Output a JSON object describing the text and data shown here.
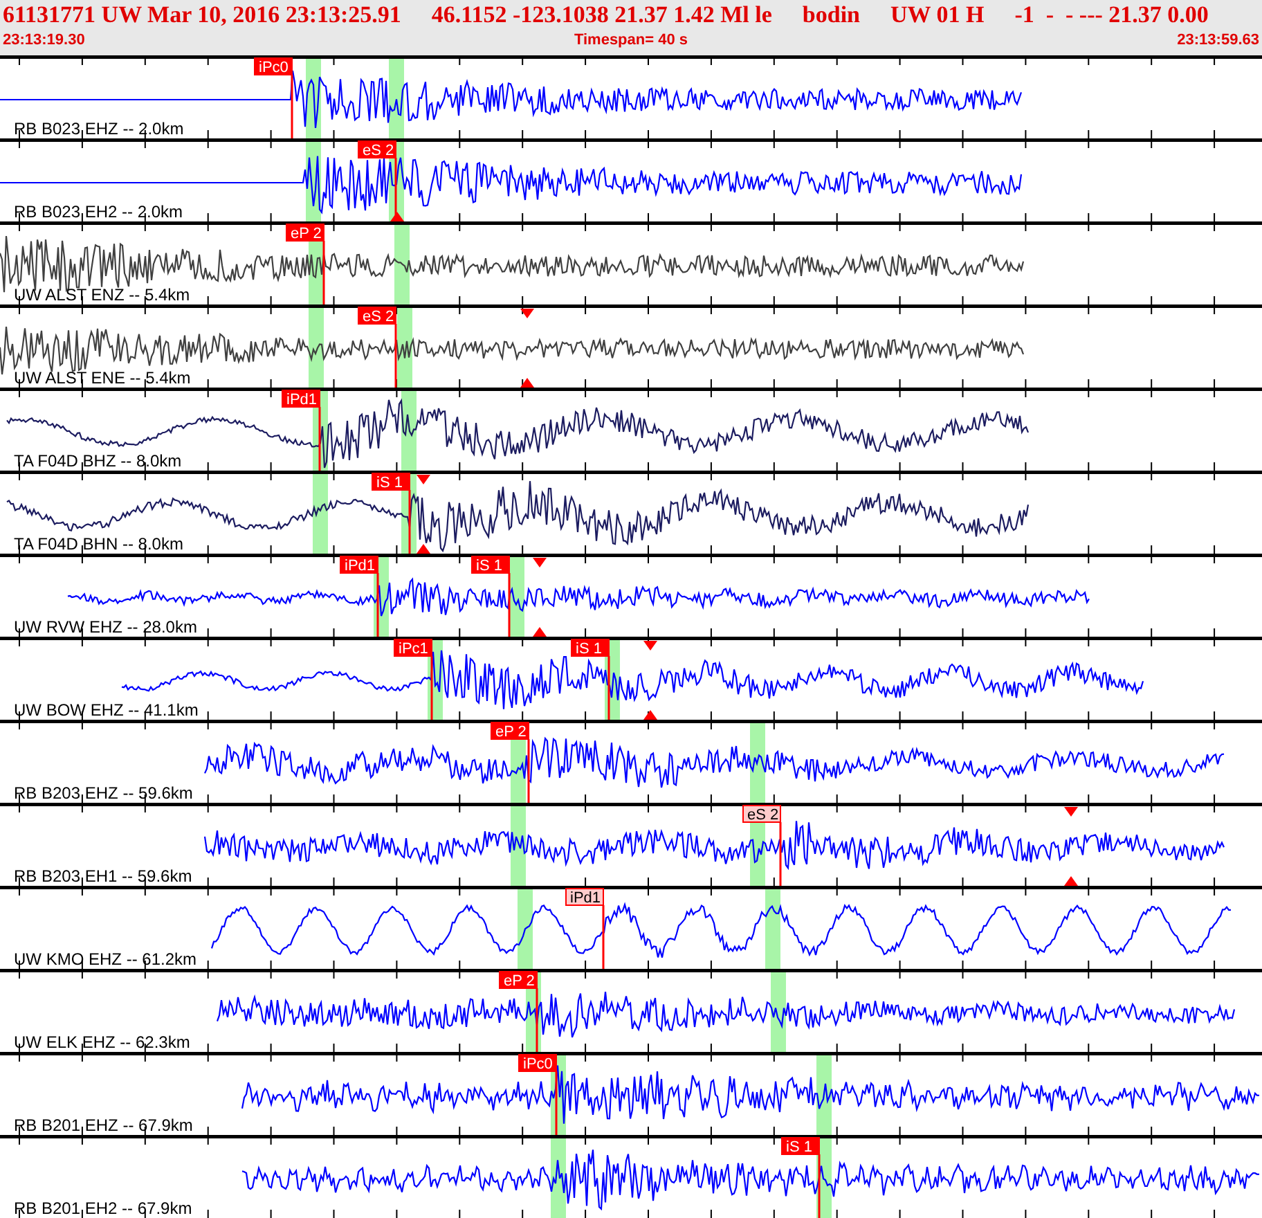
{
  "header": {
    "event": [
      "61131771 UW Mar 10, 2016 23:13:25.91",
      "46.1152 -123.1038 21.37 1.42 Ml le",
      "bodin",
      "UW 01 H",
      "-1  -  - --- 21.37 0.00"
    ],
    "start_time": "23:13:19.30",
    "timespan": "Timespan=  40 s",
    "end_time": "23:13:59.63"
  },
  "traces": [
    {
      "label": "RB B023 EHZ -- 2.0km",
      "color": "#0000ff",
      "picks": [
        {
          "label": "iPc0",
          "kind": "strong"
        }
      ]
    },
    {
      "label": "RB B023 EH2 -- 2.0km",
      "color": "#0000ff",
      "picks": [
        {
          "label": "eS 2",
          "kind": "strong"
        }
      ]
    },
    {
      "label": "UW ALST ENZ -- 5.4km",
      "color": "#404040",
      "picks": [
        {
          "label": "eP 2",
          "kind": "strong"
        }
      ]
    },
    {
      "label": "UW ALST ENE -- 5.4km",
      "color": "#404040",
      "picks": [
        {
          "label": "eS 2",
          "kind": "strong"
        }
      ]
    },
    {
      "label": "TA F04D BHZ -- 8.0km",
      "color": "#1c1c60",
      "picks": [
        {
          "label": "iPd1",
          "kind": "strong"
        }
      ]
    },
    {
      "label": "TA F04D BHN -- 8.0km",
      "color": "#1c1c60",
      "picks": [
        {
          "label": "iS 1",
          "kind": "strong"
        }
      ]
    },
    {
      "label": "UW RVW EHZ -- 28.0km",
      "color": "#0000ff",
      "picks": [
        {
          "label": "iPd1",
          "kind": "strong"
        },
        {
          "label": "iS 1",
          "kind": "strong"
        }
      ]
    },
    {
      "label": "UW BOW EHZ -- 41.1km",
      "color": "#0000ff",
      "picks": [
        {
          "label": "iPc1",
          "kind": "strong"
        },
        {
          "label": "iS 1",
          "kind": "strong"
        }
      ]
    },
    {
      "label": "RB B203 EHZ -- 59.6km",
      "color": "#0000ff",
      "picks": [
        {
          "label": "eP 2",
          "kind": "strong"
        }
      ]
    },
    {
      "label": "RB B203 EH1 -- 59.6km",
      "color": "#0000ff",
      "picks": [
        {
          "label": "eS 2",
          "kind": "weak"
        }
      ]
    },
    {
      "label": "UW KMO EHZ -- 61.2km",
      "color": "#0000ff",
      "picks": [
        {
          "label": "iPd1",
          "kind": "weak"
        }
      ]
    },
    {
      "label": "UW ELK EHZ -- 62.3km",
      "color": "#0000ff",
      "picks": [
        {
          "label": "eP 2",
          "kind": "strong"
        }
      ]
    },
    {
      "label": "RB B201 EHZ -- 67.9km",
      "color": "#0000ff",
      "picks": [
        {
          "label": "iPc0",
          "kind": "strong"
        }
      ]
    },
    {
      "label": "RB B201 EH2 -- 67.9km",
      "color": "#0000ff",
      "picks": [
        {
          "label": "iS 1",
          "kind": "strong"
        }
      ]
    }
  ]
}
